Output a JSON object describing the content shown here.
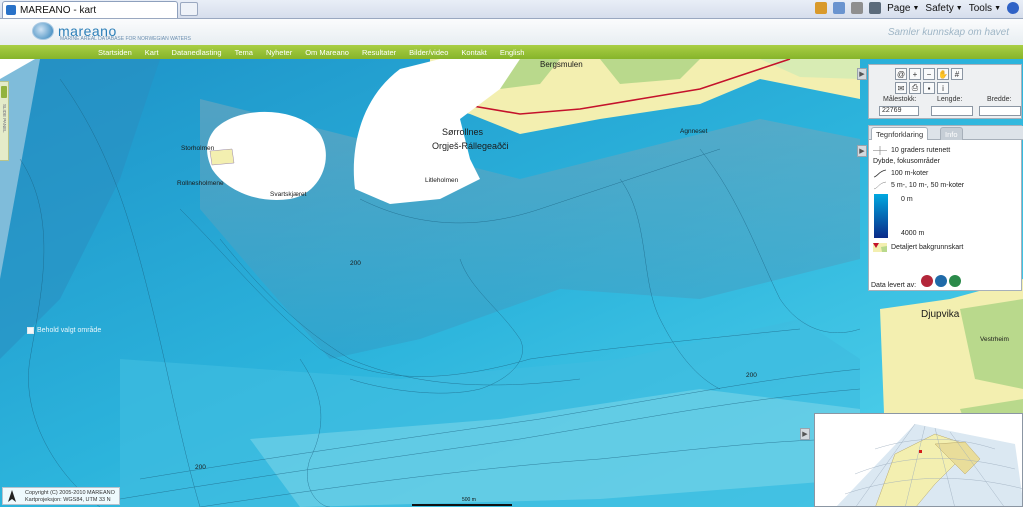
{
  "browser": {
    "tab_title": "MAREANO - kart",
    "menus": [
      "Page",
      "Safety",
      "Tools"
    ]
  },
  "site": {
    "logo_text": "mareano",
    "logo_subtext": "MARINE AREAL DATABASE FOR NORWEGIAN WATERS",
    "tagline": "Samler kunnskap om havet"
  },
  "nav": {
    "items": [
      "Startsiden",
      "Kart",
      "Datanedlasting",
      "Tema",
      "Nyheter",
      "Om Mareano",
      "Resultater",
      "Bilder/video",
      "Kontakt",
      "English"
    ]
  },
  "map": {
    "place_labels": {
      "bergsmulen": "Bergsmulen",
      "sorrollnes": "Sørrollnes",
      "orgjes": "Orgješ-Rállegeaðči",
      "litleholmen": "Litleholmen",
      "agnneset": "Agnneset",
      "storholmen": "Storholmen",
      "rollnesholmene": "Rollnesholmene",
      "svartskjaeret": "Svartskjæret",
      "djupvika": "Djupvika",
      "vestrheim": "Vestrheim"
    },
    "contour_labels": [
      "200",
      "200",
      "200"
    ],
    "left_tab_text": "SLIDE PANEL",
    "keep_area_label": "Behold valgt område"
  },
  "tools": {
    "measure_scale_label": "Målestokk:",
    "measure_scale_value": "22769",
    "length_label": "Lengde:",
    "width_label": "Bredde:",
    "icons_row1": [
      "@",
      "zoom-in",
      "zoom-out",
      "pan",
      "grid"
    ],
    "icons_row2": [
      "mail",
      "print",
      "save",
      "info"
    ]
  },
  "legend": {
    "tab_legend": "Tegnforklaring",
    "tab_info": "Info",
    "grid_label": "10 graders rutenett",
    "depth_heading": "Dybde, fokusområder",
    "contour100": "100 m-koter",
    "contour_fine": "5 m-, 10 m-, 50 m-koter",
    "depth_top": "0 m",
    "depth_bottom": "4000 m",
    "background_label": "Detaljert bakgrunnskart",
    "data_by": "Data levert av:"
  },
  "footer": {
    "copyright_line1": "Copyright (C) 2005-2010 MAREANO",
    "copyright_line2": "Kartprojeksjon: WGS84, UTM 33 N",
    "scalebar_label": "500 m"
  },
  "colors": {
    "nav_green": "#96c03a",
    "sea_shallow": "#4fd0ec",
    "sea_deep": "#1f8fc4",
    "land": "#f3efb0",
    "land_green": "#b9d98c",
    "road": "#c4122b"
  }
}
